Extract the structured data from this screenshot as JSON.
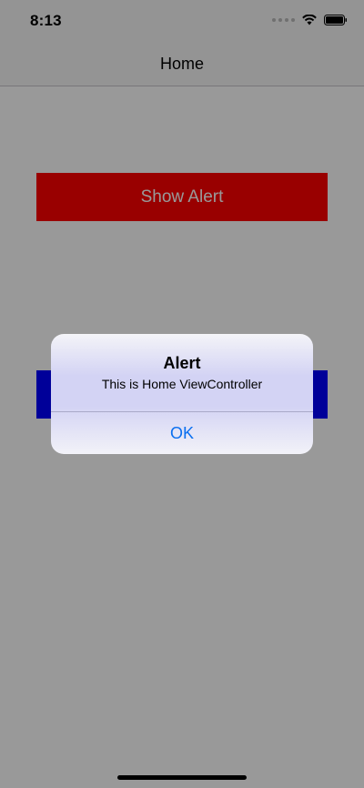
{
  "status_bar": {
    "time": "8:13"
  },
  "nav": {
    "title": "Home"
  },
  "content": {
    "show_alert_label": "Show Alert"
  },
  "alert": {
    "title": "Alert",
    "message": "This is Home ViewController",
    "ok_label": "OK"
  },
  "colors": {
    "show_alert_bg": "#ff0000",
    "second_button_bg": "#0000ff",
    "ok_text": "#0a6ff0"
  }
}
